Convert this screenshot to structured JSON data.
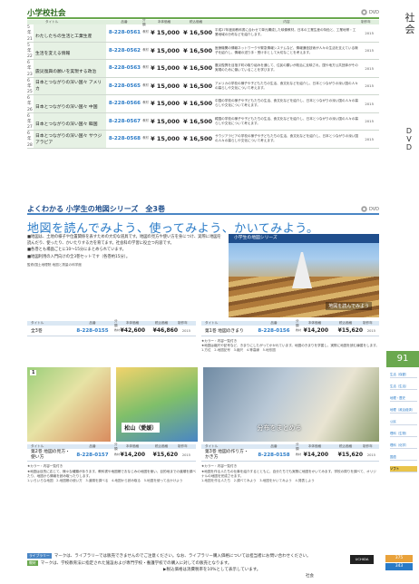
{
  "section1": {
    "title": "小学校社会",
    "badge": "DVD",
    "headers": [
      "タイトル",
      "品番",
      "分類",
      "本体価格",
      "税込価格",
      "内容",
      "制作年"
    ],
    "rows": [
      {
        "grade": "5年",
        "no": "21",
        "title": "わたしたちの生活と工業生産",
        "code": "8-228-0561",
        "cat": "教材",
        "p1": "¥ 15,000",
        "p2": "¥ 16,500",
        "desc": "平成27年度用教科書に合わせて単元構成した映像教材。日本の工業生産の特色と、工業地帯・工業地域の分布などを紹介します。",
        "year": "2015"
      },
      {
        "grade": "5年",
        "no": "22",
        "title": "生活を変える情報",
        "code": "8-228-0562",
        "cat": "教材",
        "p1": "¥ 15,000",
        "p2": "¥ 16,500",
        "desc": "医療機関の情報ネットワークや緊急情報システムなど、情報通信技術が人々の生活を支えている様子を紹介し、情報の送り手・受け手として大切なことを考えます。",
        "year": "2015"
      },
      {
        "grade": "6年",
        "no": "23",
        "title": "震災復興の願いを実現する政治",
        "code": "8-228-0563",
        "cat": "教材",
        "p1": "¥ 15,000",
        "p2": "¥ 16,500",
        "desc": "震災復興を目指す町の取り組みを通して、住民の願いが政治に反映され、国や地方公共団体がその実現のために働いていることを学びます。",
        "year": "2015"
      },
      {
        "grade": "6年",
        "no": "25",
        "title": "日本とつながりの深い国々 アメリカ",
        "code": "8-228-0565",
        "cat": "教材",
        "p1": "¥ 15,000",
        "p2": "¥ 16,500",
        "desc": "アメリカの学校の様子や子どもたちの生活、食文化などを紹介し、日本とつながりの深い国の人々の暮らしや文化について考えます。",
        "year": "2015"
      },
      {
        "grade": "6年",
        "no": "26",
        "title": "日本とつながりの深い国々 中国",
        "code": "8-228-0566",
        "cat": "教材",
        "p1": "¥ 15,000",
        "p2": "¥ 16,500",
        "desc": "中国の学校の様子や子どもたちの生活、食文化などを紹介し、日本とつながりの深い国の人々の暮らしや文化について考えます。",
        "year": "2015"
      },
      {
        "grade": "6年",
        "no": "27",
        "title": "日本とつながりの深い国々 韓国",
        "code": "8-228-0567",
        "cat": "教材",
        "p1": "¥ 15,000",
        "p2": "¥ 16,500",
        "desc": "韓国の学校の様子や子どもたちの生活、食文化などを紹介し、日本とつながりの深い国の人々の暮らしや文化について考えます。",
        "year": "2015"
      },
      {
        "grade": "6年",
        "no": "28",
        "title": "日本とつながりの深い国々 サウジアラビア",
        "code": "8-228-0568",
        "cat": "教材",
        "p1": "¥ 15,000",
        "p2": "¥ 16,500",
        "desc": "サウジアラビアの学校の様子や子どもたちの生活、食文化などを紹介し、日本とつながりの深い国の人々の暮らしや文化について考えます。",
        "year": "2015"
      }
    ]
  },
  "section2": {
    "title": "よくわかる 小学生の地図シリーズ　全3巻",
    "badge": "DVD",
    "headline": "地図を読んでみよう、使ってみよう、かいてみよう。",
    "bullets": [
      "■地図は、土地の様子や位置関係を表すための大切な道具です。地図の見方や使い方を身につけ、実際に地図を読んだり、使ったり、かいたりする力を育てます。社会科の学習に役立つ内容です。",
      "■各巻とも場面ごとに10～15分にまとめられています。",
      "■地図利用の入門向けの全3巻セットです（各巻約15分）。"
    ],
    "credit": "監修/国土地理院 地図と測量の科学館",
    "hero_bar": "小学生の地図シリーズ",
    "hero_caption": "地図を読んでみよう",
    "set_headers": [
      "タイトル",
      "品番",
      "分類",
      "本体価格",
      "税込価格",
      "制作年"
    ],
    "set": {
      "title": "全3巻",
      "code": "8-228-0155",
      "cat": "教材",
      "p1": "¥42,600",
      "p2": "¥46,860",
      "year": "2015"
    },
    "vol1": {
      "title": "第1巻 地図のきまり",
      "code": "8-228-0156",
      "cat": "教材",
      "p1": "¥14,200",
      "p2": "¥15,620",
      "year": "2015",
      "notes": "★カラー・内容一覧付き\n★地図は縮尺や記号など、きまりにしたがってかかれています。地図のきまりを学習し、実際に地図を読む練習をします。",
      "caps": "1.方位　2.地図記号　3.縮尺　4.等高線　5.地形図"
    },
    "vol2": {
      "title": "第2巻 地図の見方・使い方",
      "code": "8-228-0157",
      "cat": "教材",
      "p1": "¥14,200",
      "p2": "¥15,620",
      "year": "2015",
      "notes": "★カラー・内容一覧付き\n★地図は目的に応じて、様々な種類があります。教科書や地図帳でおなじみの地図を使い、目的地までの道順を調べたり、地図から情報を読み取ったりします。",
      "caps": "1.いろいろな地図　2.地図帳の使い方　3.道順を調べる　4.地図から読み取る　5.地図を使って出かけよう",
      "pic_num": "1",
      "pic_label": "松山（愛媛）"
    },
    "vol3": {
      "title": "第3巻 地図の作り方・かき方",
      "code": "8-228-0158",
      "cat": "教材",
      "p1": "¥14,200",
      "p2": "¥15,620",
      "year": "2015",
      "notes": "★カラー・内容一覧付き\n★地図を作る人たちの仕事を紹介するとともに、自分たちでも実際に地図をかいてみます。学校の周りを調べて、オリジナルの地図を完成させます。",
      "caps": "1.地図を作る人たち　2.調べてみよう　3.地図をかいてみよう　4.発表しよう",
      "pic_label": "分布をまとめる"
    }
  },
  "sidebar": {
    "category_top": "社会",
    "category_mid": "DVD",
    "page_number": "91",
    "index_items": [
      "生活（保健）",
      "生活（生活）",
      "地理・歴史",
      "地理（政治経済）",
      "公民",
      "理科（生物）",
      "理科（化学）",
      "国語"
    ],
    "active_index": "ソフト"
  },
  "footer": {
    "line1_badge": "ライブラリー",
    "line1": "マークは、ライブラリーでは販売できませんのでご注意ください。なお、ライブラリー購入価格については担当者にお問い合わせください。",
    "line2_badge": "教材",
    "line2": "マークは、学校教育法に指定された施設および専門学校・養護学校での購入に対しての販売となります。",
    "line3": "▶税込価格は消費税率を10%として表示しています。",
    "brand": "UCHIDA",
    "page_a": "375",
    "page_b": "343",
    "cat_label": "社会"
  },
  "colors": {
    "accent_green": "#6aa84f",
    "accent_blue": "#2a7bc7",
    "index_active": "#e9c44a"
  }
}
